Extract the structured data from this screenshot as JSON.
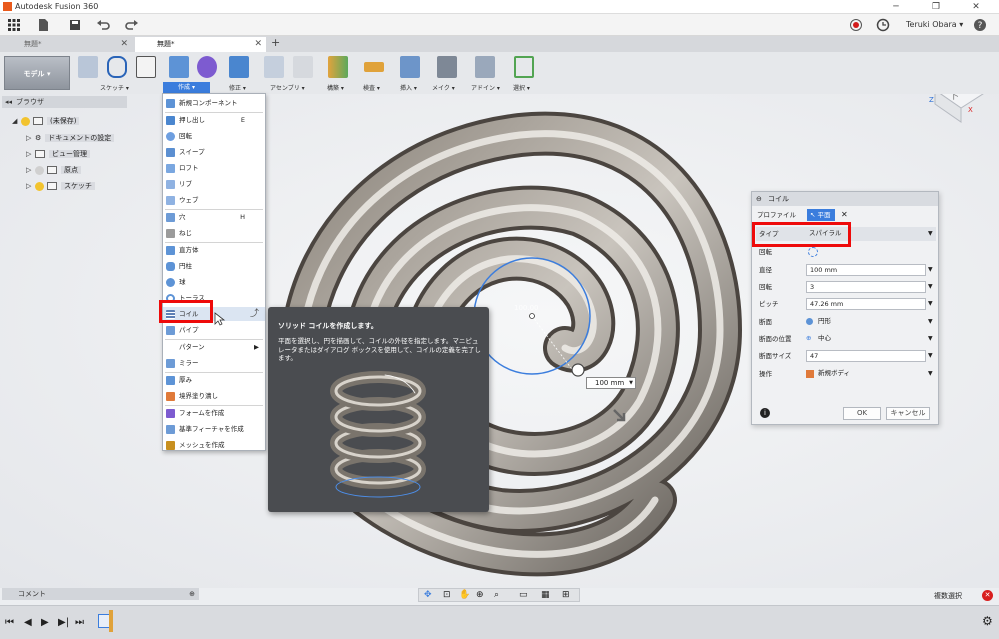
{
  "window": {
    "title": "Autodesk Fusion 360"
  },
  "toolbar": {
    "user_name": "Teruki Obara ▾"
  },
  "tabs": [
    {
      "label": "無題*",
      "active": false
    },
    {
      "label": "無題*",
      "active": true
    }
  ],
  "ribbon": {
    "workspace": "モデル ▾",
    "groups": [
      "スケッチ ▾",
      "作成 ▾",
      "修正 ▾",
      "アセンブリ ▾",
      "構築 ▾",
      "検査 ▾",
      "挿入 ▾",
      "メイク ▾",
      "アドイン ▾",
      "選択 ▾"
    ]
  },
  "browser": {
    "title": "ブラウザ",
    "root": "(未保存)",
    "items": [
      "ドキュメントの設定",
      "ビュー管理",
      "原点",
      "スケッチ"
    ]
  },
  "create_menu": {
    "items": [
      {
        "label": "新規コンポーネント",
        "key": ""
      },
      {
        "label": "押し出し",
        "key": "E"
      },
      {
        "label": "回転",
        "key": ""
      },
      {
        "label": "スイープ",
        "key": ""
      },
      {
        "label": "ロフト",
        "key": ""
      },
      {
        "label": "リブ",
        "key": ""
      },
      {
        "label": "ウェブ",
        "key": ""
      },
      {
        "label": "穴",
        "key": "H"
      },
      {
        "label": "ねじ",
        "key": ""
      },
      {
        "label": "直方体",
        "key": ""
      },
      {
        "label": "円柱",
        "key": ""
      },
      {
        "label": "球",
        "key": ""
      },
      {
        "label": "トーラス",
        "key": ""
      },
      {
        "label": "コイル",
        "key": ""
      },
      {
        "label": "パイプ",
        "key": ""
      },
      {
        "label": "パターン",
        "key": "▶"
      },
      {
        "label": "ミラー",
        "key": ""
      },
      {
        "label": "厚み",
        "key": ""
      },
      {
        "label": "境界塗り潰し",
        "key": ""
      },
      {
        "label": "フォームを作成",
        "key": ""
      },
      {
        "label": "基準フィーチャを作成",
        "key": ""
      },
      {
        "label": "メッシュを作成",
        "key": ""
      }
    ]
  },
  "tooltip": {
    "title": "ソリッド コイルを作成します。",
    "body": "平面を選択し、円を描画して、コイルの外径を指定します。マニピュレータまたはダイアログ ボックスを使用して、コイルの定義を完了します。"
  },
  "viewport": {
    "diameter_input": "100 mm",
    "diameter_ghost": "100.00"
  },
  "coil_dialog": {
    "title": "コイル",
    "tab_profile": "プロファイル",
    "tab_plane": "平面",
    "rows": [
      {
        "label": "タイプ",
        "value": "スパイラル"
      },
      {
        "label": "回転",
        "value": ""
      },
      {
        "label": "直径",
        "value": "100 mm"
      },
      {
        "label": "回転",
        "value": "3"
      },
      {
        "label": "ピッチ",
        "value": "47.26 mm"
      },
      {
        "label": "断面",
        "value": "円形"
      },
      {
        "label": "断面の位置",
        "value": "中心"
      },
      {
        "label": "断面サイズ",
        "value": "47"
      },
      {
        "label": "操作",
        "value": "新規ボディ"
      }
    ],
    "ok": "OK",
    "cancel": "キャンセル"
  },
  "bottom": {
    "comments": "コメント",
    "multi_select": "複数選択"
  },
  "colors": {
    "accent": "#3b7ddd",
    "highlight": "#ee0a0a"
  }
}
